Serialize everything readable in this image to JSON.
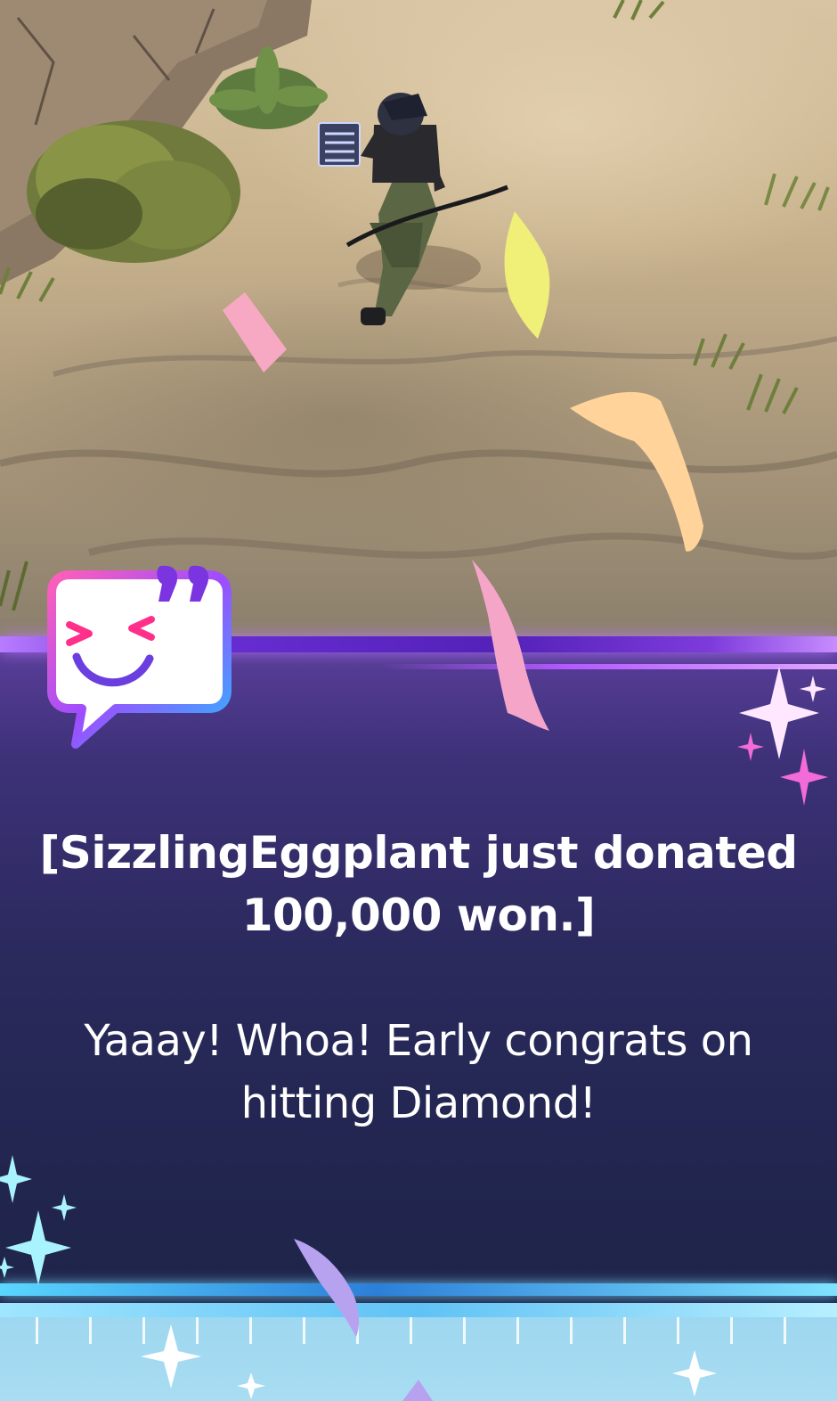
{
  "notification": {
    "donation_line_1": "[SizzlingEggplant just donated",
    "donation_line_2": "100,000 won.]",
    "message_line_1": "Yaaay! Whoa! Early congrats on",
    "message_line_2": "hitting Diamond!"
  },
  "icons": {
    "chat": "smiling-speech-bubble-icon",
    "sparkle": "sparkle-icon"
  },
  "colors": {
    "panel_top": "#5b3f9c",
    "panel_bottom": "#1f2449",
    "band_purple": "#6b2fd6",
    "band_cyan": "#5ad6ff",
    "text": "#ffffff",
    "confetti_pink": "#f7a9c4",
    "confetti_yellow": "#f2f07a",
    "confetti_peach": "#ffd49a",
    "confetti_lilac": "#b8a3f2"
  }
}
